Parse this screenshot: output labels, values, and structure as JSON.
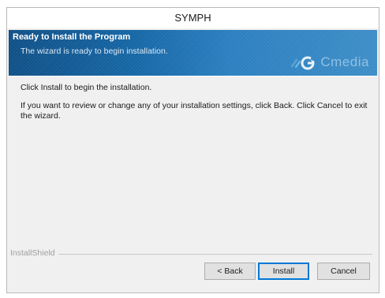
{
  "window": {
    "title": "SYMPH"
  },
  "banner": {
    "title": "Ready to Install the Program",
    "subtitle": "The wizard is ready to begin installation.",
    "brand_text": "Cmedia",
    "brand_icon": "cmedia-logo-icon"
  },
  "content": {
    "line1": "Click Install to begin the installation.",
    "line2": "If you want to review or change any of your installation settings, click Back. Click Cancel to exit the wizard."
  },
  "footer": {
    "vendor": "InstallShield"
  },
  "buttons": {
    "back": "< Back",
    "install": "Install",
    "cancel": "Cancel"
  },
  "colors": {
    "banner_dark": "#0f4f86",
    "banner_light": "#3d8dc7",
    "dialog_bg": "#f0f0f0",
    "default_button_border": "#0078d7"
  }
}
